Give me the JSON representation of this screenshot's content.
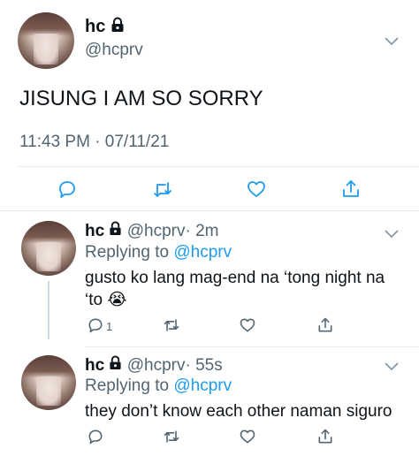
{
  "main_tweet": {
    "name": "hc",
    "handle": "@hcprv",
    "text": "JISUNG I AM SO SORRY",
    "timestamp": "11:43 PM · 07/11/21"
  },
  "replies": [
    {
      "name": "hc",
      "handle": "@hcprv",
      "time": "· 2m",
      "replying_prefix": "Replying to",
      "replying_handle": "@hcprv",
      "text_line1": "gusto ko lang mag-end na ‘tong night na",
      "text_line2": "‘to",
      "emoji": "😭",
      "reply_count": "1"
    },
    {
      "name": "hc",
      "handle": "@hcprv",
      "time": "· 55s",
      "replying_prefix": "Replying to",
      "replying_handle": "@hcprv",
      "text_line1": "they don’t know each other naman siguro"
    }
  ],
  "colors": {
    "text": "#0f1419",
    "muted": "#536471",
    "accent": "#1d9bf0",
    "divider": "#e6ecf0"
  },
  "icons": [
    "lock-icon",
    "chevron-down-icon",
    "reply-icon",
    "retweet-icon",
    "like-icon",
    "share-icon"
  ]
}
